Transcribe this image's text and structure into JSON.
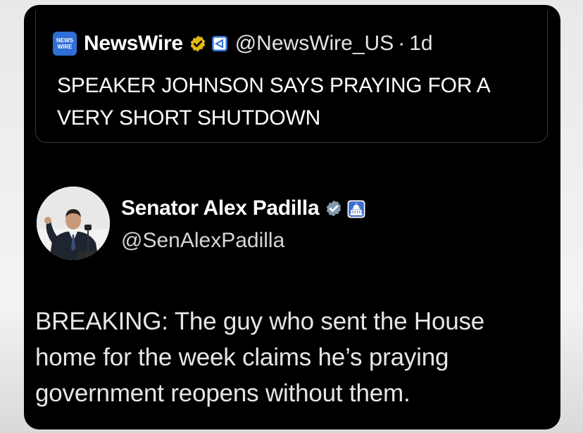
{
  "quoted_post": {
    "logo_line1": "NEWS",
    "logo_line2": "WIRE",
    "display_name": "NewsWire",
    "handle": "@NewsWire_US",
    "separator": "·",
    "time": "1d",
    "text": "SPEAKER JOHNSON SAYS PRAYING FOR A VERY SHORT SHUTDOWN",
    "verified_badge_icon": "gold-verified-badge-icon",
    "affiliate_icon": "affiliate-badge-icon"
  },
  "post": {
    "display_name": "Senator Alex Padilla",
    "handle": "@SenAlexPadilla",
    "text": "BREAKING: The guy who sent the House home for the week claims he’s praying government reopens without them.",
    "verified_badge_icon": "gray-verified-badge-icon",
    "affiliation_icon": "capitol-building-icon"
  },
  "colors": {
    "card_bg": "#000000",
    "gold_badge": "#e2b719",
    "gray_badge": "#829aab",
    "logo_blue": "#2f6fd6"
  }
}
